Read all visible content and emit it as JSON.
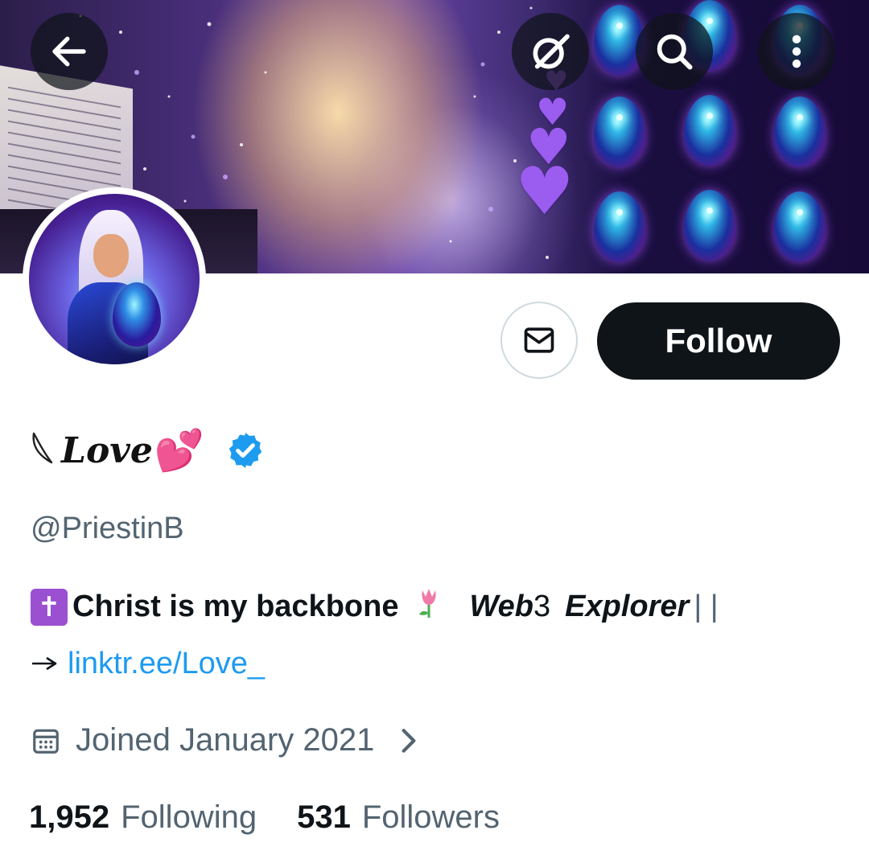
{
  "profile": {
    "display_name": "Love",
    "name_decoration": "💕",
    "handle": "@PriestinB",
    "verified": true,
    "bio": {
      "line1_main": "Christ is my backbone",
      "line1_tag1_bold": "Web",
      "line1_tag1_rest": "3",
      "line1_tag2": "Explorer",
      "line1_separator": "| |",
      "link": "linktr.ee/Love_"
    },
    "joined": "Joined January 2021",
    "following_count": "1,952",
    "following_label": "Following",
    "followers_count": "531",
    "followers_label": "Followers"
  },
  "actions": {
    "follow_label": "Follow"
  },
  "icons": {
    "back": "arrow-left-icon",
    "grok": "grok-icon",
    "search": "search-icon",
    "more": "more-vertical-icon",
    "message": "envelope-icon",
    "verified": "verified-badge-icon",
    "calendar": "calendar-icon",
    "chevron": "chevron-right-icon"
  },
  "colors": {
    "accent": "#1d9bf0",
    "text_primary": "#0f1419",
    "text_secondary": "#536471",
    "follow_bg": "#0f1419",
    "cross_bg": "#9b4fd1"
  }
}
